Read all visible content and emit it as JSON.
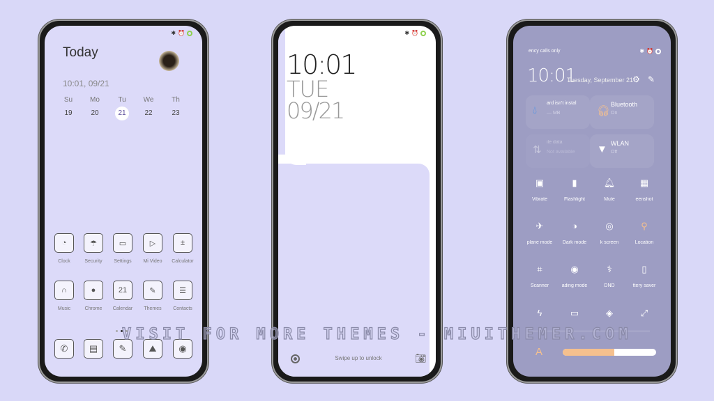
{
  "home": {
    "title": "Today",
    "datetime": "10:01,  09/21",
    "weekdays": [
      "Su",
      "Mo",
      "Tu",
      "We",
      "Th"
    ],
    "dates": [
      "19",
      "20",
      "21",
      "22",
      "23"
    ],
    "selected_date": "21",
    "apps_row1": [
      {
        "label": "Clock",
        "icon": "clock-icon",
        "g": "◔"
      },
      {
        "label": "Security",
        "icon": "umbrella-icon",
        "g": "☂"
      },
      {
        "label": "Settings",
        "icon": "toggle-icon",
        "g": "▭"
      },
      {
        "label": "Mi Video",
        "icon": "play-icon",
        "g": "▷"
      },
      {
        "label": "Calculator",
        "icon": "calculator-icon",
        "g": "±"
      }
    ],
    "apps_row2": [
      {
        "label": "Music",
        "icon": "headphones-icon",
        "g": "∩"
      },
      {
        "label": "Chrome",
        "icon": "chrome-icon",
        "g": "●"
      },
      {
        "label": "Calendar",
        "icon": "calendar-icon",
        "g": "21"
      },
      {
        "label": "Themes",
        "icon": "brush-icon",
        "g": "✎"
      },
      {
        "label": "Contacts",
        "icon": "contact-icon",
        "g": "☰"
      }
    ],
    "dock": [
      {
        "icon": "phone-icon",
        "g": "✆"
      },
      {
        "icon": "messages-icon",
        "g": "▤"
      },
      {
        "icon": "notes-icon",
        "g": "✎"
      },
      {
        "icon": "gallery-icon",
        "g": "⛰"
      },
      {
        "icon": "camera-icon",
        "g": "◉"
      }
    ]
  },
  "lock": {
    "time": "10:01",
    "day": "TUE",
    "date": "09/21",
    "hint": "Swipe up to unlock"
  },
  "control": {
    "carrier": "ency calls only",
    "time": "10:01",
    "date": "Tuesday, September 21",
    "tiles": [
      {
        "title": "ard isn't instal",
        "sub": "— MB",
        "icon": "data-drop-icon"
      },
      {
        "title": "Bluetooth",
        "sub": "On",
        "icon": "headphones-icon"
      },
      {
        "title": "ile data",
        "sub": "Not available",
        "icon": "mobile-data-icon"
      },
      {
        "title": "WLAN",
        "sub": "Off",
        "icon": "wifi-icon"
      }
    ],
    "toggles": [
      {
        "label": "Vibrate",
        "g": "▣",
        "icon": "vibrate-icon"
      },
      {
        "label": "Flashlight",
        "g": "▮",
        "icon": "flashlight-icon"
      },
      {
        "label": "Mute",
        "g": "🔔︎",
        "icon": "bell-icon"
      },
      {
        "label": "eenshot",
        "g": "▦",
        "icon": "screenshot-icon"
      },
      {
        "label": "plane mode",
        "g": "✈",
        "icon": "airplane-icon"
      },
      {
        "label": "Dark mode",
        "g": "◑",
        "icon": "dark-mode-icon"
      },
      {
        "label": "k screen",
        "g": "◎",
        "icon": "fingerprint-icon"
      },
      {
        "label": "Location",
        "g": "⚲",
        "icon": "location-icon",
        "on": true
      },
      {
        "label": "Scanner",
        "g": "⌗",
        "icon": "scanner-icon"
      },
      {
        "label": "ading mode",
        "g": "◉",
        "icon": "reading-mode-icon"
      },
      {
        "label": "DND",
        "g": "⚕",
        "icon": "dnd-icon"
      },
      {
        "label": "ttery saver",
        "g": "▯",
        "icon": "battery-icon"
      },
      {
        "label": "",
        "g": "ϟ",
        "icon": "power-icon"
      },
      {
        "label": "",
        "g": "▭",
        "icon": "cast-icon"
      },
      {
        "label": "",
        "g": "◈",
        "icon": "link-icon"
      },
      {
        "label": "",
        "g": "⤢",
        "icon": "resize-icon"
      }
    ],
    "brightness": 0.55,
    "accent": "#f5c08e"
  },
  "watermark": "VISIT FOR MORE THEMES - MIUITHEMER.COM"
}
